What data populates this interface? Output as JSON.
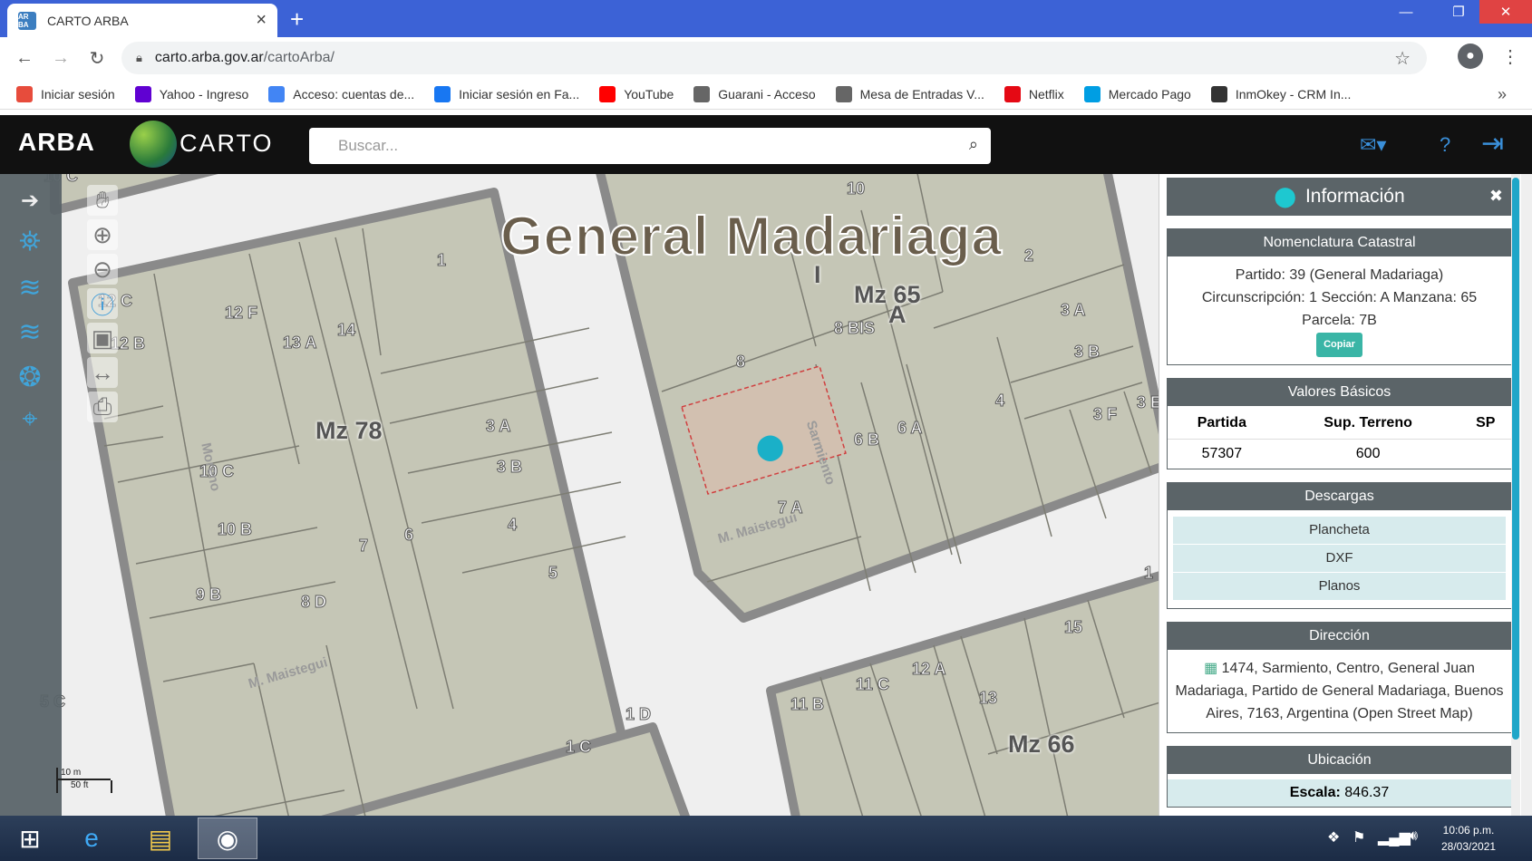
{
  "browser": {
    "tab_title": "CARTO ARBA",
    "tab_favicon": "AR BA",
    "url_domain": "carto.arba.gov.ar",
    "url_path": "/cartoArba/",
    "bookmarks": [
      {
        "label": "Iniciar sesión",
        "icon": "microsoft-icon",
        "color": "#e74c3c"
      },
      {
        "label": "Yahoo - Ingreso",
        "icon": "yahoo-icon",
        "color": "#6001d2"
      },
      {
        "label": "Acceso: cuentas de...",
        "icon": "google-icon",
        "color": "#4285f4"
      },
      {
        "label": "Iniciar sesión en Fa...",
        "icon": "facebook-icon",
        "color": "#1877f2"
      },
      {
        "label": "YouTube",
        "icon": "youtube-icon",
        "color": "#ff0000"
      },
      {
        "label": "Guarani - Acceso",
        "icon": "globe-icon",
        "color": "#666666"
      },
      {
        "label": "Mesa de Entradas V...",
        "icon": "globe-icon",
        "color": "#666666"
      },
      {
        "label": "Netflix",
        "icon": "netflix-icon",
        "color": "#e50914"
      },
      {
        "label": "Mercado Pago",
        "icon": "mercadopago-icon",
        "color": "#009ee3"
      },
      {
        "label": "InmOkey - CRM In...",
        "icon": "inmokey-icon",
        "color": "#333333"
      }
    ],
    "bookmarks_more": "»"
  },
  "app": {
    "brand": "ARBA",
    "product": "CARTO",
    "search_placeholder": "Buscar..."
  },
  "map": {
    "title": "General Madariaga",
    "labels": [
      {
        "text": "10 C"
      },
      {
        "text": "1"
      },
      {
        "text": "12 C"
      },
      {
        "text": "12 F"
      },
      {
        "text": "12 B"
      },
      {
        "text": "13 A"
      },
      {
        "text": "14"
      },
      {
        "text": "Mz 78"
      },
      {
        "text": "3 A"
      },
      {
        "text": "3 B"
      },
      {
        "text": "10 C"
      },
      {
        "text": "10 B"
      },
      {
        "text": "4"
      },
      {
        "text": "7"
      },
      {
        "text": "6"
      },
      {
        "text": "5"
      },
      {
        "text": "9 B"
      },
      {
        "text": "8 D"
      },
      {
        "text": "10"
      },
      {
        "text": "2"
      },
      {
        "text": "Mz 65"
      },
      {
        "text": "A"
      },
      {
        "text": "I"
      },
      {
        "text": "8 BIS"
      },
      {
        "text": "3 A"
      },
      {
        "text": "3 B"
      },
      {
        "text": "8"
      },
      {
        "text": "4"
      },
      {
        "text": "6 B"
      },
      {
        "text": "6 A"
      },
      {
        "text": "3 F"
      },
      {
        "text": "3 E"
      },
      {
        "text": "7 A"
      },
      {
        "text": "1"
      },
      {
        "text": "15"
      },
      {
        "text": "12 A"
      },
      {
        "text": "11 C"
      },
      {
        "text": "11 B"
      },
      {
        "text": "13"
      },
      {
        "text": "Mz 66"
      },
      {
        "text": "1 D"
      },
      {
        "text": "1 C"
      },
      {
        "text": "5 C"
      }
    ],
    "streets": [
      "Moreno",
      "Sarmiento",
      "M. Maistegui",
      "M. Maistegui"
    ],
    "scale_labels": [
      "10 m",
      "50 ft"
    ]
  },
  "panel": {
    "title": "Información",
    "nomenclatura": {
      "header": "Nomenclatura Catastral",
      "line1": "Partido: 39 (General Madariaga)",
      "line2": "Circunscripción: 1 Sección: A Manzana: 65",
      "line3": "Parcela: 7B",
      "copy_label": "Copiar"
    },
    "valores": {
      "header": "Valores Básicos",
      "columns": [
        "Partida",
        "Sup. Terreno",
        "SP"
      ],
      "row": [
        "57307",
        "600",
        ""
      ]
    },
    "descargas": {
      "header": "Descargas",
      "items": [
        "Plancheta",
        "DXF",
        "Planos"
      ]
    },
    "direccion": {
      "header": "Dirección",
      "text": "1474, Sarmiento, Centro, General Juan Madariaga, Partido de General Madariaga, Buenos Aires, 7163, Argentina (Open Street Map)"
    },
    "ubicacion": {
      "header": "Ubicación",
      "scale_label": "Escala:",
      "scale_value": "846.37"
    }
  },
  "taskbar": {
    "time": "10:06 p.m.",
    "date": "28/03/2021"
  },
  "colors": {
    "accent": "#3a8fd9",
    "panel_header": "#5b6468",
    "tab_bar": "#3c62d6",
    "parcel": "#c5c6b6",
    "parcel_border": "#8a8a8a",
    "selected_parcel": "#d2c0b0"
  }
}
